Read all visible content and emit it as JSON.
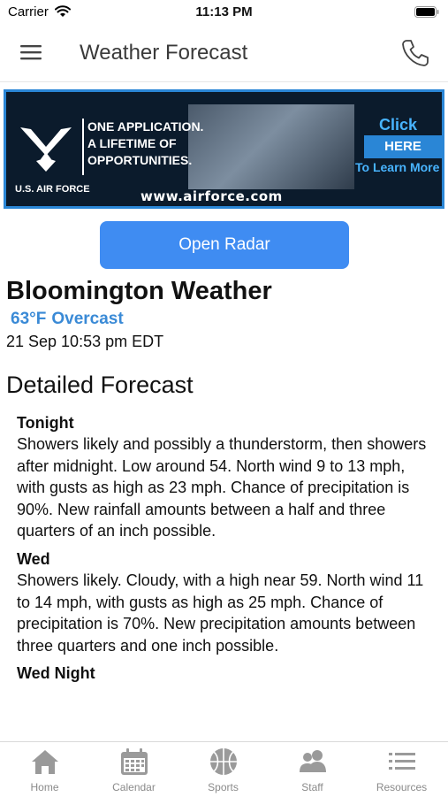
{
  "status_bar": {
    "carrier": "Carrier",
    "time": "11:13 PM"
  },
  "nav": {
    "title": "Weather Forecast",
    "menu_icon": "hamburger-menu-icon",
    "phone_icon": "phone-icon"
  },
  "ad": {
    "tagline_lines": [
      "ONE APPLICATION.",
      "A LIFETIME OF",
      "OPPORTUNITIES."
    ],
    "brand": "U.S. AIR FORCE",
    "url": "www.airforce.com",
    "click": "Click",
    "here": "HERE",
    "learn_more": "To Learn More"
  },
  "radar_button": "Open Radar",
  "city": {
    "title": "Bloomington Weather",
    "temperature": "63°F",
    "condition": "Overcast",
    "updated": "21 Sep 10:53 pm EDT"
  },
  "forecast": {
    "heading": "Detailed Forecast",
    "periods": [
      {
        "name": "Tonight",
        "text": "Showers likely and possibly a thunderstorm, then showers after midnight. Low around 54. North wind 9 to 13 mph, with gusts as high as 23 mph. Chance of precipitation is 90%. New rainfall amounts between a half and three quarters of an inch possible."
      },
      {
        "name": "Wed",
        "text": "Showers likely. Cloudy, with a high near 59. North wind 11 to 14 mph, with gusts as high as 25 mph. Chance of precipitation is 70%. New precipitation amounts between three quarters and one inch possible."
      },
      {
        "name": "Wed Night",
        "text": ""
      }
    ]
  },
  "tabs": [
    {
      "label": "Home",
      "icon": "home-icon"
    },
    {
      "label": "Calendar",
      "icon": "calendar-icon"
    },
    {
      "label": "Sports",
      "icon": "basketball-icon"
    },
    {
      "label": "Staff",
      "icon": "people-icon"
    },
    {
      "label": "Resources",
      "icon": "list-icon"
    }
  ],
  "colors": {
    "accent": "#3f8cf2",
    "condition_text": "#3a8ad6",
    "tab_inactive": "#8a8a8a"
  }
}
